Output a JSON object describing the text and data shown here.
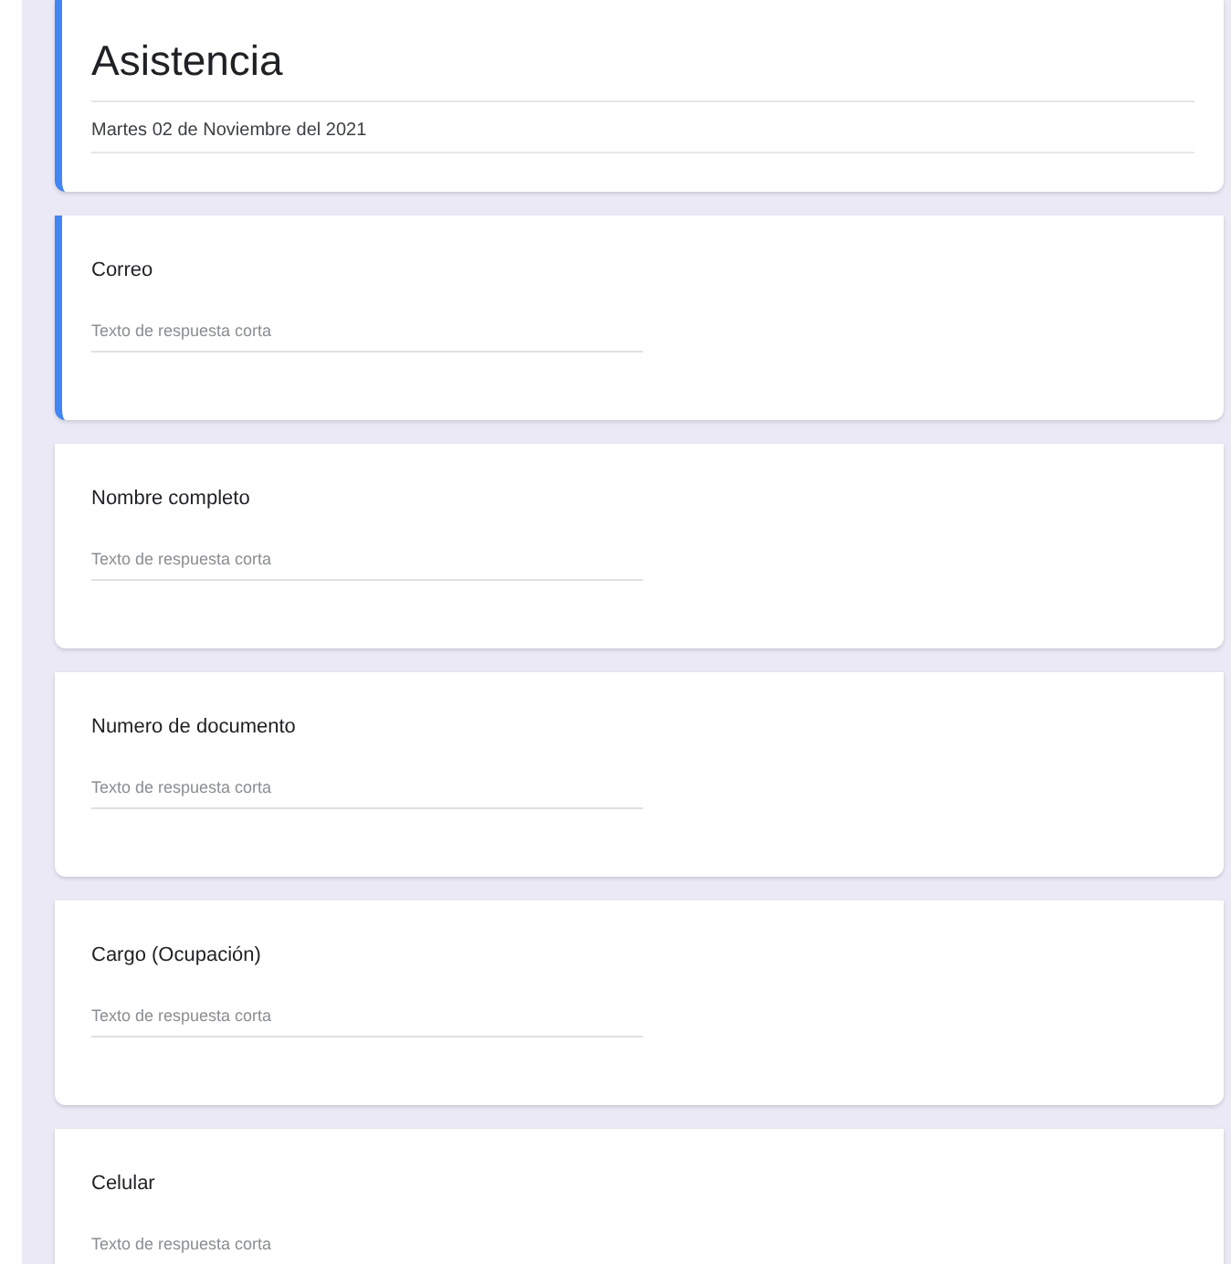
{
  "header": {
    "title": "Asistencia",
    "description": "Martes 02 de Noviembre del 2021",
    "selected": true
  },
  "questions": [
    {
      "label": "Correo",
      "placeholder": "Texto de respuesta corta",
      "selected": true
    },
    {
      "label": "Nombre completo",
      "placeholder": "Texto de respuesta corta",
      "selected": false
    },
    {
      "label": "Numero de documento",
      "placeholder": "Texto de respuesta corta",
      "selected": false
    },
    {
      "label": "Cargo (Ocupación)",
      "placeholder": "Texto de respuesta corta",
      "selected": false
    },
    {
      "label": "Celular",
      "placeholder": "Texto de respuesta corta",
      "selected": false
    }
  ]
}
